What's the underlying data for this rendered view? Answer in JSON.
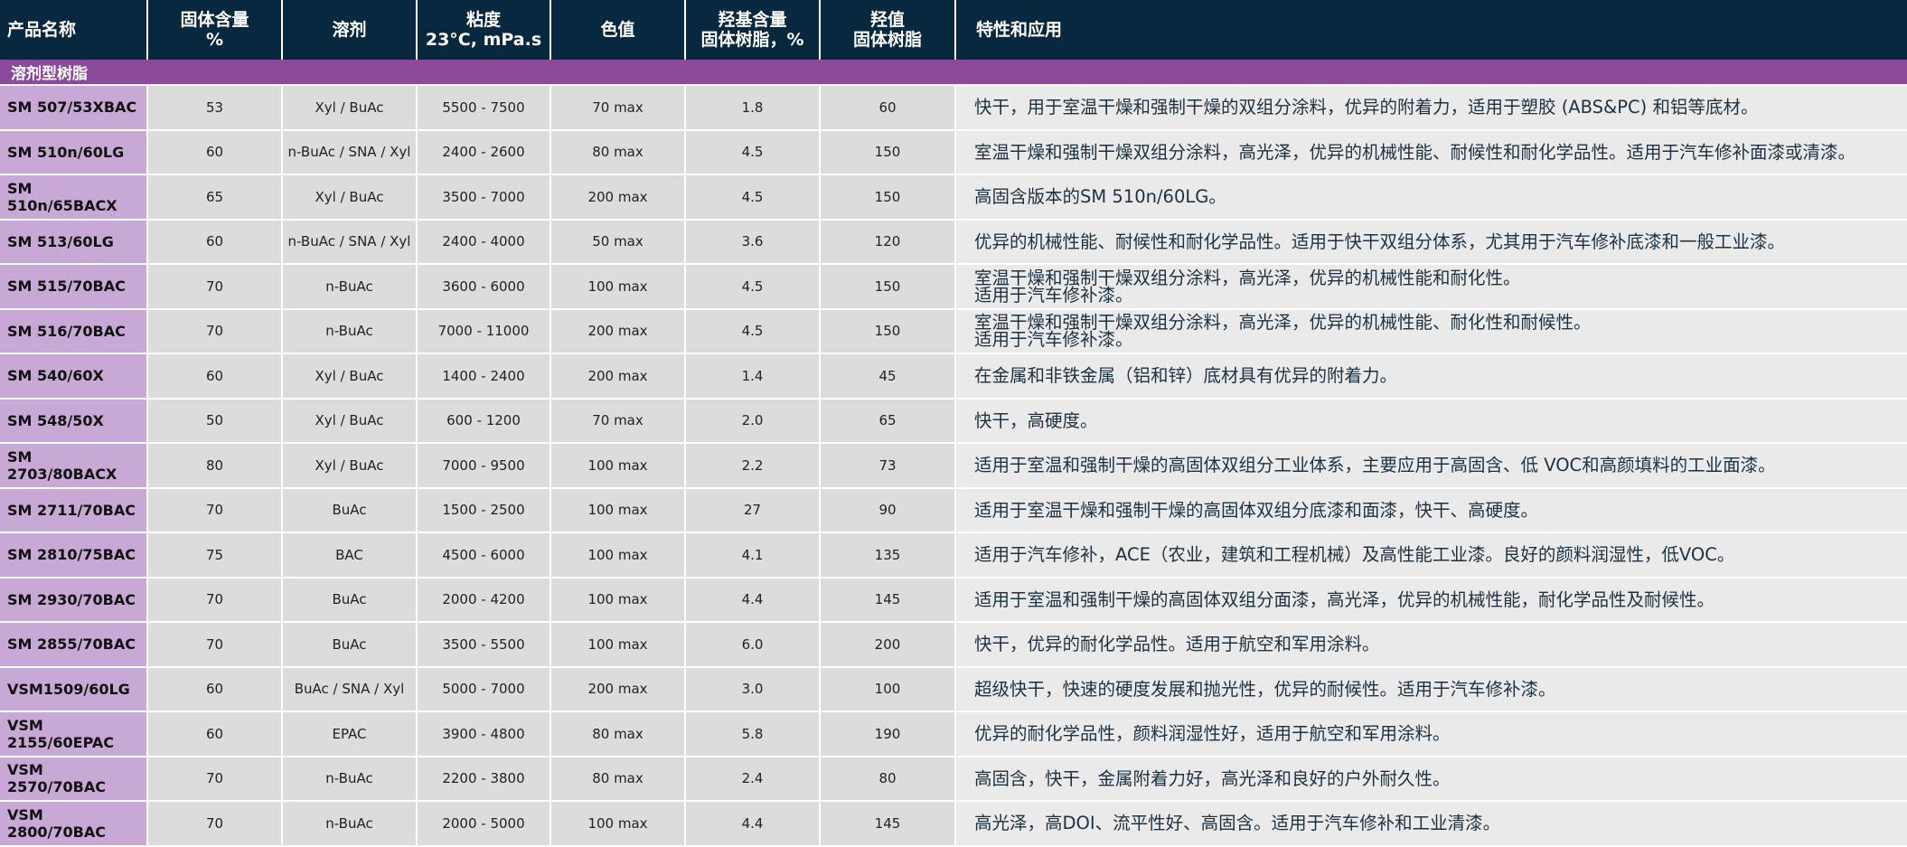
{
  "header": {
    "product_name": "产品名称",
    "solid_content": "固体含量\n%",
    "solvent": "溶剂",
    "viscosity": "粘度\n23°C, mPa.s",
    "color_value": "色值",
    "hydroxyl_content": "羟基含量\n固体树脂，%",
    "hydroxyl_value": "羟值\n固体树脂",
    "properties": "特性和应用"
  },
  "section_title": "溶剂型树脂",
  "rows": [
    {
      "name": "SM 507/53XBAC",
      "solid": "53",
      "solvent": "Xyl / BuAc",
      "viscosity": "5500 - 7500",
      "color": "70 max",
      "oh_content": "1.8",
      "oh_value": "60",
      "application": "快干，用于室温干燥和强制干燥的双组分涂料，优异的附着力，适用于塑胶 (ABS&PC) 和铝等底材。"
    },
    {
      "name": "SM 510n/60LG",
      "solid": "60",
      "solvent": "n-BuAc / SNA / Xyl",
      "viscosity": "2400 - 2600",
      "color": "80 max",
      "oh_content": "4.5",
      "oh_value": "150",
      "application": "室温干燥和强制干燥双组分涂料，高光泽，优异的机械性能、耐候性和耐化学品性。适用于汽车修补面漆或清漆。"
    },
    {
      "name": "SM 510n/65BACX",
      "solid": "65",
      "solvent": "Xyl / BuAc",
      "viscosity": "3500 - 7000",
      "color": "200 max",
      "oh_content": "4.5",
      "oh_value": "150",
      "application": "高固含版本的SM 510n/60LG。"
    },
    {
      "name": "SM 513/60LG",
      "solid": "60",
      "solvent": "n-BuAc / SNA / Xyl",
      "viscosity": "2400 - 4000",
      "color": "50 max",
      "oh_content": "3.6",
      "oh_value": "120",
      "application": "优异的机械性能、耐候性和耐化学品性。适用于快干双组分体系，尤其用于汽车修补底漆和一般工业漆。"
    },
    {
      "name": "SM 515/70BAC",
      "solid": "70",
      "solvent": "n-BuAc",
      "viscosity": "3600 - 6000",
      "color": "100 max",
      "oh_content": "4.5",
      "oh_value": "150",
      "application": "室温干燥和强制干燥双组分涂料，高光泽，优异的机械性能和耐化性。\n适用于汽车修补漆。"
    },
    {
      "name": "SM 516/70BAC",
      "solid": "70",
      "solvent": "n-BuAc",
      "viscosity": "7000 - 11000",
      "color": "200 max",
      "oh_content": "4.5",
      "oh_value": "150",
      "application": "室温干燥和强制干燥双组分涂料，高光泽，优异的机械性能、耐化性和耐候性。\n适用于汽车修补漆。"
    },
    {
      "name": "SM 540/60X",
      "solid": "60",
      "solvent": "Xyl / BuAc",
      "viscosity": "1400 - 2400",
      "color": "200 max",
      "oh_content": "1.4",
      "oh_value": "45",
      "application": "在金属和非铁金属（铝和锌）底材具有优异的附着力。"
    },
    {
      "name": "SM 548/50X",
      "solid": "50",
      "solvent": "Xyl / BuAc",
      "viscosity": "600 - 1200",
      "color": "70 max",
      "oh_content": "2.0",
      "oh_value": "65",
      "application": "快干，高硬度。"
    },
    {
      "name": "SM 2703/80BACX",
      "solid": "80",
      "solvent": "Xyl / BuAc",
      "viscosity": "7000 - 9500",
      "color": "100 max",
      "oh_content": "2.2",
      "oh_value": "73",
      "application": "适用于室温和强制干燥的高固体双组分工业体系，主要应用于高固含、低 VOC和高颜填料的工业面漆。"
    },
    {
      "name": "SM 2711/70BAC",
      "solid": "70",
      "solvent": "BuAc",
      "viscosity": "1500 - 2500",
      "color": "100 max",
      "oh_content": "27",
      "oh_value": "90",
      "application": "适用于室温干燥和强制干燥的高固体双组分底漆和面漆，快干、高硬度。"
    },
    {
      "name": "SM 2810/75BAC",
      "solid": "75",
      "solvent": "BAC",
      "viscosity": "4500 - 6000",
      "color": "100 max",
      "oh_content": "4.1",
      "oh_value": "135",
      "application": "适用于汽车修补，ACE（农业，建筑和工程机械）及高性能工业漆。良好的颜料润湿性，低VOC。"
    },
    {
      "name": "SM 2930/70BAC",
      "solid": "70",
      "solvent": "BuAc",
      "viscosity": "2000 - 4200",
      "color": "100 max",
      "oh_content": "4.4",
      "oh_value": "145",
      "application": "适用于室温和强制干燥的高固体双组分面漆，高光泽，优异的机械性能，耐化学品性及耐候性。"
    },
    {
      "name": "SM 2855/70BAC",
      "solid": "70",
      "solvent": "BuAc",
      "viscosity": "3500 - 5500",
      "color": "100 max",
      "oh_content": "6.0",
      "oh_value": "200",
      "application": "快干，优异的耐化学品性。适用于航空和军用涂料。"
    },
    {
      "name": "VSM1509/60LG",
      "solid": "60",
      "solvent": "BuAc / SNA / Xyl",
      "viscosity": "5000 - 7000",
      "color": "200 max",
      "oh_content": "3.0",
      "oh_value": "100",
      "application": "超级快干，快速的硬度发展和抛光性，优异的耐候性。适用于汽车修补漆。"
    },
    {
      "name": "VSM 2155/60EPAC",
      "solid": "60",
      "solvent": "EPAC",
      "viscosity": "3900 - 4800",
      "color": "80 max",
      "oh_content": "5.8",
      "oh_value": "190",
      "application": "优异的耐化学品性，颜料润湿性好，适用于航空和军用涂料。"
    },
    {
      "name": "VSM 2570/70BAC",
      "solid": "70",
      "solvent": "n-BuAc",
      "viscosity": "2200 - 3800",
      "color": "80 max",
      "oh_content": "2.4",
      "oh_value": "80",
      "application": "高固含，快干，金属附着力好，高光泽和良好的户外耐久性。"
    },
    {
      "name": "VSM 2800/70BAC",
      "solid": "70",
      "solvent": "n-BuAc",
      "viscosity": "2000 - 5000",
      "color": "100 max",
      "oh_content": "4.4",
      "oh_value": "145",
      "application": "高光泽，高DOI、流平性好、高固含。适用于汽车修补和工业清漆。"
    }
  ]
}
